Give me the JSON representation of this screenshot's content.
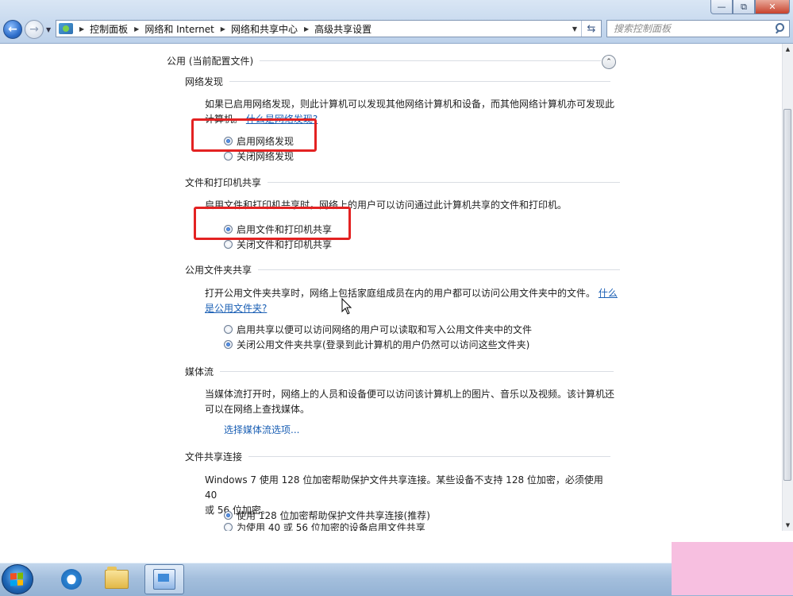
{
  "window": {
    "minimize_glyph": "—",
    "maximize_glyph": "⧉",
    "close_glyph": "✕"
  },
  "nav": {
    "back_glyph": "←",
    "forward_glyph": "→"
  },
  "address_bar": {
    "breadcrumbs": [
      "控制面板",
      "网络和 Internet",
      "网络和共享中心",
      "高级共享设置"
    ],
    "refresh_glyph": "⇆"
  },
  "search": {
    "placeholder": "搜索控制面板"
  },
  "profile": {
    "title": "公用 (当前配置文件)",
    "collapse_glyph": "⌃"
  },
  "sections": {
    "network_discovery": {
      "heading": "网络发现",
      "text_line1": "如果已启用网络发现，则此计算机可以发现其他网络计算机和设备，而其他网络计算机亦可发现此",
      "text_line2": "计算机。",
      "link": "什么是网络发现?",
      "option_on": "启用网络发现",
      "option_off": "关闭网络发现",
      "selected": "on"
    },
    "file_printer_sharing": {
      "heading": "文件和打印机共享",
      "text": "启用文件和打印机共享时，网络上的用户可以访问通过此计算机共享的文件和打印机。",
      "option_on": "启用文件和打印机共享",
      "option_off": "关闭文件和打印机共享",
      "selected": "on"
    },
    "public_folder_sharing": {
      "heading": "公用文件夹共享",
      "text_line1": "打开公用文件夹共享时，网络上包括家庭组成员在内的用户都可以访问公用文件夹中的文件。",
      "link_line1": "什么",
      "link_line2": "是公用文件夹?",
      "option_on": "启用共享以便可以访问网络的用户可以读取和写入公用文件夹中的文件",
      "option_off": "关闭公用文件夹共享(登录到此计算机的用户仍然可以访问这些文件夹)",
      "selected": "off"
    },
    "media_streaming": {
      "heading": "媒体流",
      "text_line1": "当媒体流打开时，网络上的人员和设备便可以访问该计算机上的图片、音乐以及视频。该计算机还",
      "text_line2": "可以在网络上查找媒体。",
      "link": "选择媒体流选项..."
    },
    "file_sharing_connections": {
      "heading": "文件共享连接",
      "text_line1": "Windows 7 使用 128 位加密帮助保护文件共享连接。某些设备不支持 128 位加密，必须使用 40",
      "text_line2": "或 56 位加密。",
      "option_128": "使用 128 位加密帮助保护文件共享连接(推荐)",
      "option_40_56": "为使用 40 或 56 位加密的设备启用文件共享",
      "selected": "128"
    }
  },
  "taskbar": {
    "items": [
      "start-button",
      "internet-explorer",
      "windows-explorer",
      "control-panel"
    ]
  },
  "colors": {
    "highlight_box": "#e32222",
    "link": "#1a5fb4",
    "watermark_bg": "#f7bfe0"
  }
}
